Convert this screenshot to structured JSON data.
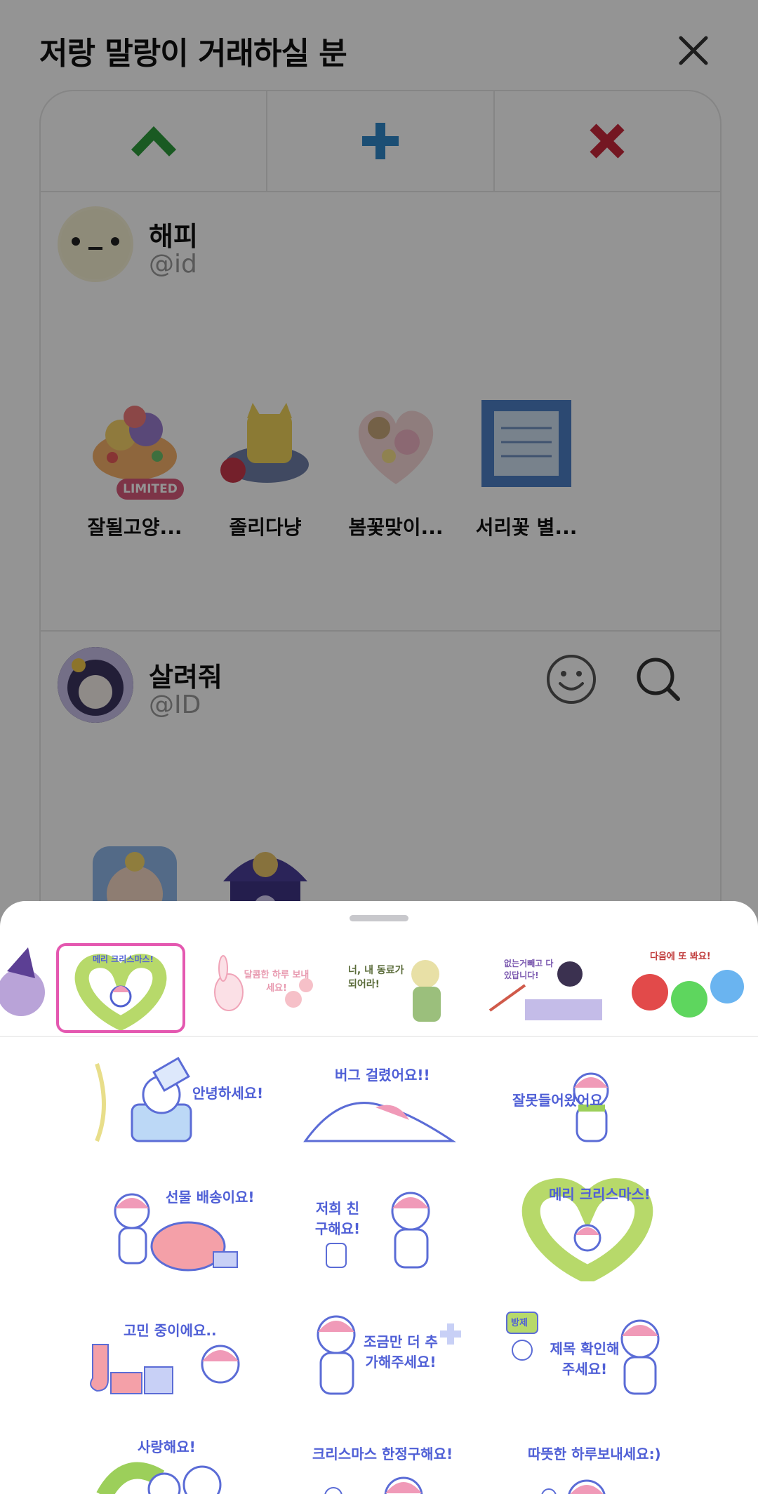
{
  "header": {
    "title": "저랑 말랑이 거래하실 분"
  },
  "actions": [
    "up-arrow",
    "plus",
    "x-mark"
  ],
  "users": [
    {
      "name": "해피",
      "id": "@id",
      "items": [
        {
          "label": "잘될고양...",
          "badge": "LIMITED"
        },
        {
          "label": "졸리다냥"
        },
        {
          "label": "봄꽃맞이..."
        },
        {
          "label": "서리꽃 별..."
        }
      ]
    },
    {
      "name": "살려줘",
      "id": "@ID"
    }
  ],
  "sheet": {
    "tabs": [
      {
        "text": ""
      },
      {
        "text": "메리 크리스마스!",
        "selected": true
      },
      {
        "text": "달콤한 하루 보내세요!"
      },
      {
        "text": "너, 내 동료가 되어라!"
      },
      {
        "text": "없는거빼고 다 있답니다!"
      },
      {
        "text": "다음에 또 봐요!"
      }
    ],
    "stickers": [
      "안녕하세요!",
      "버그 걸렸어요!!",
      "잘못들어왔어요",
      "선물 배송이요!",
      "저희 친구해요!",
      "메리 크리스마스!",
      "고민 중이에요..",
      "조금만 더 추가해주세요!",
      "제목 확인해주세요!",
      "사랑해요!",
      "크리스마스 한정구해요!",
      "따뜻한 하루보내세요:)"
    ],
    "sticker_sign": "방제"
  },
  "colors": {
    "accent": "#e458b0",
    "sticker_ink": "#4f5fd6",
    "up": "#2e9b3c",
    "plus": "#2f87c9",
    "x": "#c8283c"
  }
}
